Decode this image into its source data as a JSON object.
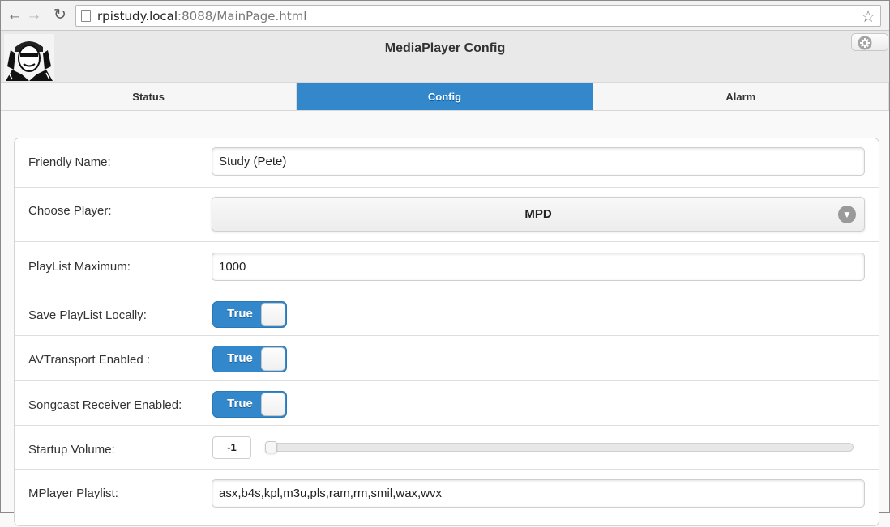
{
  "browser": {
    "url_host": "rpistudy.local",
    "url_path": ":8088/MainPage.html",
    "icons": [
      "back-icon",
      "forward-icon",
      "reload-icon",
      "page-icon",
      "star-icon"
    ]
  },
  "header": {
    "title": "MediaPlayer Config",
    "settings_icon": "gear-icon",
    "logo": "avatar-logo"
  },
  "tabs": [
    {
      "label": "Status",
      "active": false
    },
    {
      "label": "Config",
      "active": true
    },
    {
      "label": "Alarm",
      "active": false
    }
  ],
  "form": {
    "friendly_name": {
      "label": "Friendly Name:",
      "value": "Study (Pete)"
    },
    "choose_player": {
      "label": "Choose Player:",
      "value": "MPD"
    },
    "playlist_max": {
      "label": "PlayList Maximum:",
      "value": "1000"
    },
    "save_playlist": {
      "label": "Save PlayList Locally:",
      "value": "True"
    },
    "avtransport": {
      "label": "AVTransport Enabled :",
      "value": "True"
    },
    "songcast": {
      "label": "Songcast Receiver Enabled:",
      "value": "True"
    },
    "startup_volume": {
      "label": "Startup Volume:",
      "value": "-1"
    },
    "mplayer_playlist": {
      "label": "MPlayer Playlist:",
      "value": "asx,b4s,kpl,m3u,pls,ram,rm,smil,wax,wvx"
    }
  },
  "colors": {
    "accent": "#3388cc",
    "header_bg": "#e9e9e9",
    "panel_bg": "#ffffff"
  }
}
